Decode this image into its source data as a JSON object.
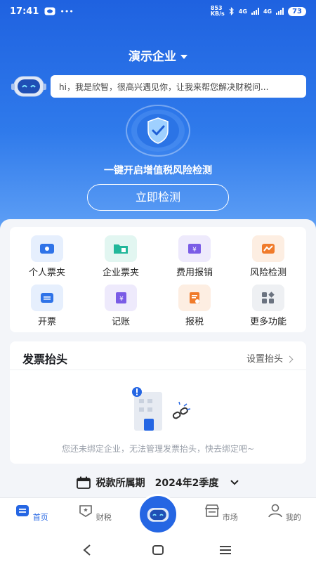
{
  "status_bar": {
    "time": "17:41",
    "net_speed_value": "853",
    "net_speed_unit": "KB/s",
    "network_1": "4G",
    "network_2": "4G",
    "battery": "73"
  },
  "header": {
    "company_name": "演示企业"
  },
  "assistant": {
    "greeting": "hi，我是欣智，很高兴遇见你，让我来帮您解决财税问..."
  },
  "risk": {
    "title": "一键开启增值税风险检测",
    "button_label": "立即检测"
  },
  "features": [
    {
      "label": "个人票夹",
      "icon": "wallet-icon",
      "color": "#2f73e8",
      "bg": "#e6effd"
    },
    {
      "label": "企业票夹",
      "icon": "folder-icon",
      "color": "#21b79a",
      "bg": "#e2f6f1"
    },
    {
      "label": "费用报销",
      "icon": "expense-icon",
      "color": "#7a5ce6",
      "bg": "#eeeafc"
    },
    {
      "label": "风险检测",
      "icon": "trend-icon",
      "color": "#f07b2b",
      "bg": "#fdeee2"
    },
    {
      "label": "开票",
      "icon": "invoice-icon",
      "color": "#2f73e8",
      "bg": "#e6effd"
    },
    {
      "label": "记账",
      "icon": "ledger-icon",
      "color": "#7a5ce6",
      "bg": "#eeeafc"
    },
    {
      "label": "报税",
      "icon": "tax-form-icon",
      "color": "#f07b2b",
      "bg": "#fdeee2"
    },
    {
      "label": "更多功能",
      "icon": "more-grid-icon",
      "color": "#6b7380",
      "bg": "#eef0f3"
    }
  ],
  "invoice_header": {
    "title": "发票抬头",
    "settings_label": "设置抬头",
    "empty_text": "您还未绑定企业，无法管理发票抬头，快去绑定吧~"
  },
  "tax_period": {
    "label": "税款所属期",
    "value": "2024年2季度"
  },
  "tabbar": {
    "tabs": [
      {
        "label": "首页"
      },
      {
        "label": "财税"
      },
      {
        "label": "市场"
      },
      {
        "label": "我的"
      }
    ]
  },
  "colors": {
    "brand": "#2566e3",
    "hero_top": "#1f62e0",
    "hero_bottom": "#63a3f6"
  }
}
